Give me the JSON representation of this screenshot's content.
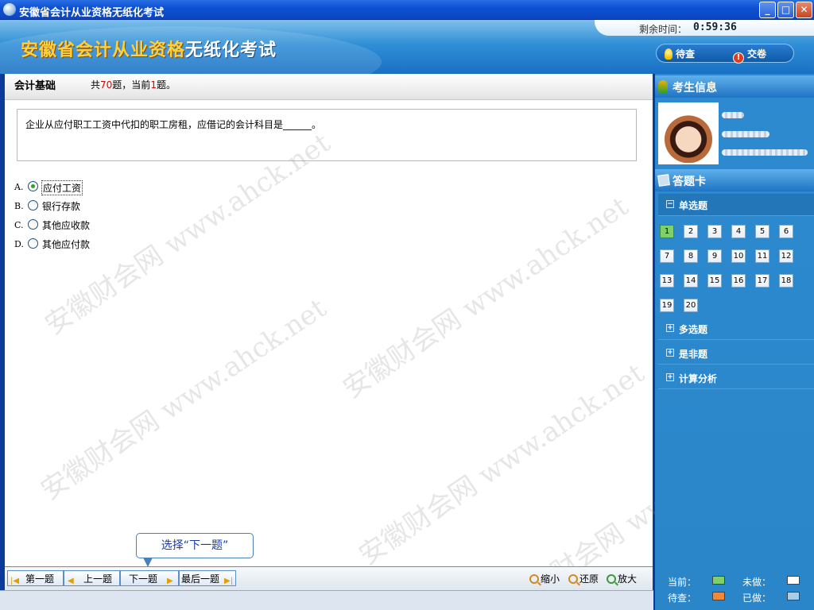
{
  "window": {
    "title": "安徽省会计从业资格无纸化考试"
  },
  "header": {
    "title_part1": "安徽省会计从业资格",
    "title_part2": "无纸化考试",
    "timer_label": "剩余时间：",
    "timer_value": "0:59:36",
    "review_label": "待查",
    "submit_label": "交卷"
  },
  "question_header": {
    "subject": "会计基础",
    "progress_prefix": "共",
    "total": "70",
    "progress_mid": "题，当前",
    "current": "1",
    "progress_suffix": "题。"
  },
  "question": {
    "text": "企业从应付职工工资中代扣的职工房租，应借记的会计科目是______。",
    "options": [
      {
        "letter": "A.",
        "text": "应付工资",
        "selected": true
      },
      {
        "letter": "B.",
        "text": "银行存款",
        "selected": false
      },
      {
        "letter": "C.",
        "text": "其他应收款",
        "selected": false
      },
      {
        "letter": "D.",
        "text": "其他应付款",
        "selected": false
      }
    ]
  },
  "tooltip": {
    "text": "选择“下一题”"
  },
  "nav": {
    "first": "第一题",
    "prev": "上一题",
    "next": "下一题",
    "last": "最后一题",
    "zoom_out": "缩小",
    "reset": "还原",
    "zoom_in": "放大"
  },
  "right_panel": {
    "candidate_info_title": "考生信息",
    "answer_card_title": "答题卡",
    "sections": [
      "单选题",
      "多选题",
      "是非题",
      "计算分析"
    ],
    "single_choice_numbers": [
      "1",
      "2",
      "3",
      "4",
      "5",
      "6",
      "7",
      "8",
      "9",
      "10",
      "11",
      "12",
      "13",
      "14",
      "15",
      "16",
      "17",
      "18",
      "19",
      "20"
    ],
    "current_question": "1"
  },
  "legend": {
    "current": "当前：",
    "unanswered": "未做：",
    "review": "待查：",
    "done": "已做：",
    "colors": {
      "current": "#7fd06a",
      "unanswered": "#ffffff",
      "review": "#f08a3a",
      "done": "#a8cde8"
    }
  },
  "watermark": {
    "text": "安徽财会网 www.ahck.net"
  }
}
